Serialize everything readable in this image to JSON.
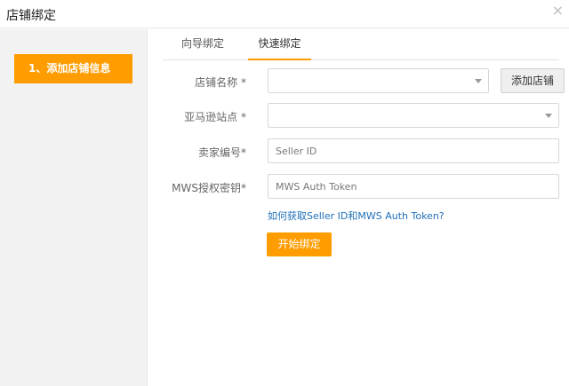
{
  "dialog": {
    "title": "店铺绑定",
    "close_label": "×"
  },
  "sidebar": {
    "steps": [
      {
        "label": "1、添加店铺信息",
        "active": true
      }
    ]
  },
  "tabs": [
    {
      "label": "向导绑定",
      "active": false
    },
    {
      "label": "快速绑定",
      "active": true
    }
  ],
  "form": {
    "store_name": {
      "label": "店铺名称 *",
      "value": ""
    },
    "add_store_button": "添加店铺",
    "amazon_site": {
      "label": "亚马逊站点 *",
      "value": ""
    },
    "seller_id": {
      "label": "卖家编号*",
      "placeholder": "Seller ID",
      "value": ""
    },
    "mws_token": {
      "label": "MWS授权密钥*",
      "placeholder": "MWS Auth Token",
      "value": ""
    },
    "help_link": "如何获取Seller ID和MWS Auth Token?",
    "submit_button": "开始绑定"
  },
  "colors": {
    "accent": "#ff9c00",
    "link": "#1f6fb8"
  },
  "icons": {
    "close": "close-icon",
    "dropdown": "chevron-down-icon"
  }
}
